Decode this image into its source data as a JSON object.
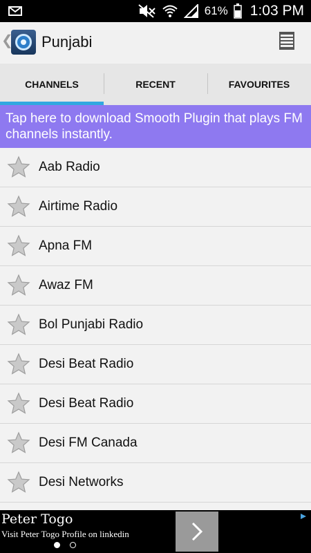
{
  "status_bar": {
    "battery_percent": "61%",
    "time": "1:03 PM",
    "icons": [
      "mail-icon",
      "mute-icon",
      "wifi-icon",
      "signal-icon",
      "battery-icon"
    ]
  },
  "action_bar": {
    "title": "Punjabi",
    "menu_icon": "menu-icon"
  },
  "tabs": [
    {
      "label": "CHANNELS",
      "active": true
    },
    {
      "label": "RECENT",
      "active": false
    },
    {
      "label": "FAVOURITES",
      "active": false
    }
  ],
  "promo": {
    "text": "Tap here to download Smooth Plugin that plays FM channels instantly."
  },
  "channels": [
    {
      "name": "Aab Radio"
    },
    {
      "name": "Airtime Radio"
    },
    {
      "name": "Apna FM"
    },
    {
      "name": "Awaz FM"
    },
    {
      "name": "Bol Punjabi Radio"
    },
    {
      "name": "Desi Beat Radio"
    },
    {
      "name": "Desi Beat Radio"
    },
    {
      "name": "Desi FM Canada"
    },
    {
      "name": "Desi Networks"
    }
  ],
  "ad": {
    "headline": "Peter Togo",
    "subtext": "Visit Peter Togo Profile on linkedin",
    "page_count": 2,
    "active_page": 1
  },
  "colors": {
    "accent_tab": "#31a8e0",
    "promo_bg": "#8e79f0"
  }
}
